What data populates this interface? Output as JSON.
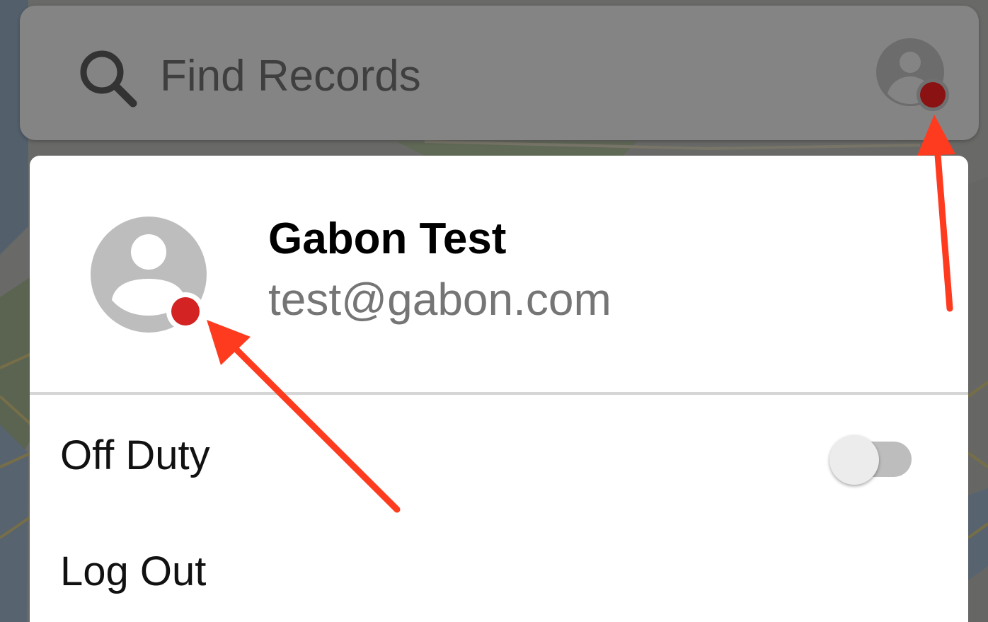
{
  "search": {
    "placeholder": "Find Records",
    "icon": "search-icon"
  },
  "account_button": {
    "icon": "account-icon",
    "status_dot_color": "#8a1212"
  },
  "profile": {
    "name": "Gabon Test",
    "email": "test@gabon.com",
    "avatar_icon": "account-icon",
    "status_dot_color": "#d32323"
  },
  "menu": {
    "off_duty_label": "Off Duty",
    "off_duty_enabled": false,
    "logout_label": "Log Out"
  },
  "annotation_arrow_color": "#ff3b1f"
}
